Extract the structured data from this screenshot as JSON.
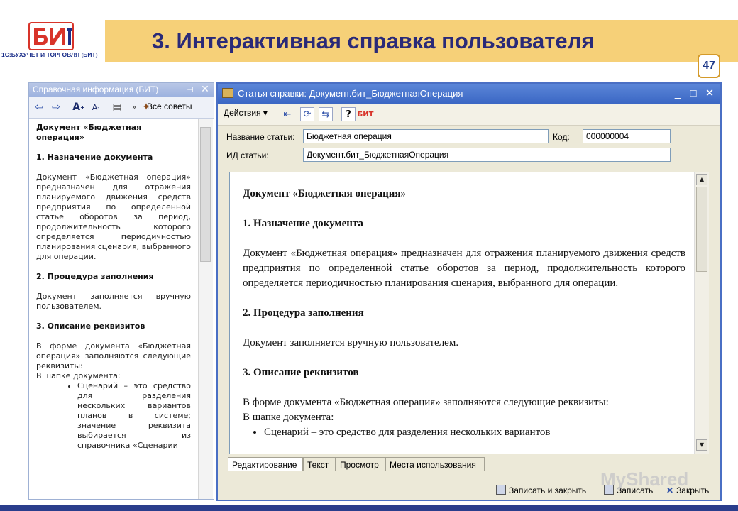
{
  "slide": {
    "title": "3. Интерактивная справка пользователя",
    "page_number": "47",
    "logo_text": "БИТ",
    "logo_caption": "1С:БУХУЧЕТ И ТОРГОВЛЯ (БИТ)",
    "watermark": "MyShared"
  },
  "left_panel": {
    "title": "Справочная информация (БИТ)",
    "pin_icon": "⊣",
    "close_icon": "✕",
    "all_tips_label": "Все советы",
    "content": {
      "heading": "Документ «Бюджетная операция»",
      "s1_title": "1.   Назначение документа",
      "s1_text": "Документ «Бюджетная операция» предназначен для отражения планируемого движения средств предприятия по определенной статье оборотов за период, продолжительность которого определяется периодичностью планирования сценария, выбранного для операции.",
      "s2_title": "2.   Процедура заполнения",
      "s2_text": "Документ заполняется вручную пользователем.",
      "s3_title": "3.   Описание реквизитов",
      "s3_text": "В форме документа «Бюджетная операция» заполняются следующие реквизиты:",
      "s3_sub": "В шапке документа:",
      "bullet": "Сценарий – это средство для разделения нескольких вариантов планов в системе; значение реквизита выбирается из справочника «Сценарии"
    }
  },
  "dialog": {
    "title": "Статья справки: Документ.бит_БюджетнаяОперация",
    "win_minimize": "_",
    "win_maximize": "□",
    "win_close": "✕",
    "actions_label": "Действия ▾",
    "help_icon_label": "?",
    "bit_icon_label": "БИТ",
    "fields": {
      "name_label": "Название статьи:",
      "name_value": "Бюджетная операция",
      "code_label": "Код:",
      "code_value": "000000004",
      "id_label": "ИД статьи:",
      "id_value": "Документ.бит_БюджетнаяОперация"
    },
    "editor": {
      "heading": "Документ «Бюджетная операция»",
      "s1_title": "1.   Назначение документа",
      "s1_text": "Документ «Бюджетная операция» предназначен для отражения планируемого движения средств предприятия по определенной статье оборотов за период, продолжительность которого определяется периодичностью планирования сценария, выбранного для операции.",
      "s2_title": "2.   Процедура заполнения",
      "s2_text": "Документ заполняется вручную пользователем.",
      "s3_title": "3.   Описание реквизитов",
      "s3_text": "В форме документа «Бюджетная операция» заполняются следующие реквизиты:",
      "s3_sub": "В шапке документа:",
      "bullet": "Сценарий – это средство для разделения нескольких вариантов"
    },
    "tabs": [
      "Редактирование",
      "Текст",
      "Просмотр",
      "Места использования"
    ],
    "active_tab": "Редактирование",
    "buttons": {
      "save_close": "Записать и закрыть",
      "save": "Записать",
      "close": "Закрыть"
    }
  }
}
